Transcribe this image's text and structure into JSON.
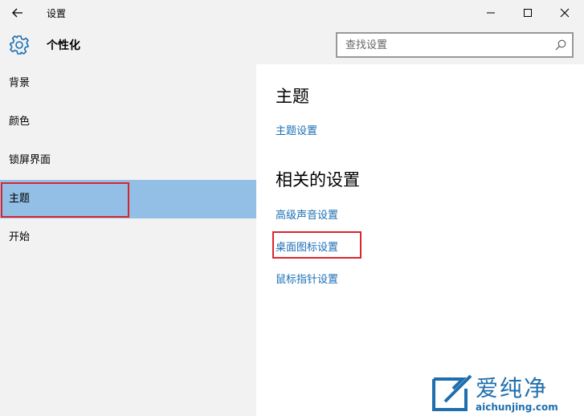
{
  "window": {
    "title": "设置"
  },
  "header": {
    "title": "个性化",
    "search_placeholder": "查找设置"
  },
  "sidebar": {
    "items": [
      {
        "label": "背景"
      },
      {
        "label": "颜色"
      },
      {
        "label": "锁屏界面"
      },
      {
        "label": "主题",
        "selected": true
      },
      {
        "label": "开始"
      }
    ]
  },
  "main": {
    "theme_heading": "主题",
    "theme_settings_link": "主题设置",
    "related_heading": "相关的设置",
    "related_links": [
      {
        "label": "高级声音设置"
      },
      {
        "label": "桌面图标设置",
        "highlighted": true
      },
      {
        "label": "鼠标指针设置"
      }
    ]
  },
  "watermark": {
    "text_cn": "爱纯净",
    "text_en": "aichunjing.com"
  },
  "colors": {
    "accent_link": "#1a6fb5",
    "selected_bg": "#93bfe6",
    "highlight_box": "#d9262d",
    "chrome_bg": "#f2f2f2"
  }
}
